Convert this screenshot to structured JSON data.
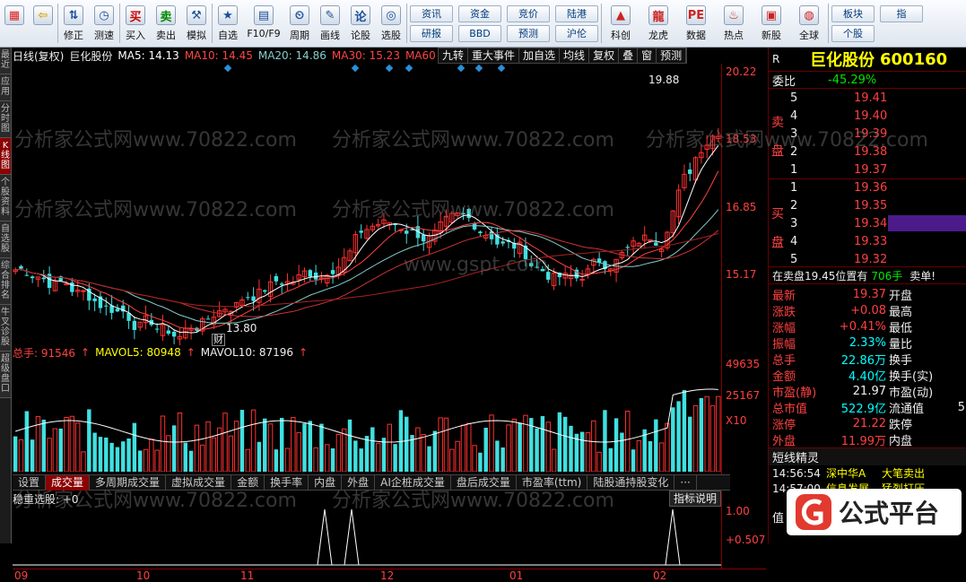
{
  "toolbar": {
    "buttons": [
      {
        "label": "",
        "icon": "windows-logo-icon"
      },
      {
        "label": "",
        "icon": "back-arrow-icon"
      },
      {
        "label": "修正",
        "icon": "up-down-arrows-icon"
      },
      {
        "label": "测速",
        "icon": "clock-icon"
      },
      {
        "label": "买入",
        "icon": "buy-icon",
        "glyph": "买"
      },
      {
        "label": "卖出",
        "icon": "sell-icon",
        "glyph": "卖"
      },
      {
        "label": "模拟",
        "icon": "hammer-icon"
      },
      {
        "label": "自选",
        "icon": "star-folder-icon"
      },
      {
        "label": "F10/F9",
        "icon": "f10-icon"
      },
      {
        "label": "周期",
        "icon": "period-icon"
      },
      {
        "label": "画线",
        "icon": "pencil-icon"
      },
      {
        "label": "论股",
        "icon": "discuss-icon"
      },
      {
        "label": "选股",
        "icon": "select-stock-icon"
      }
    ],
    "dual_buttons": [
      [
        "资讯",
        "研报"
      ],
      [
        "资金",
        "BBD"
      ],
      [
        "竞价",
        "预测"
      ],
      [
        "陆港",
        "沪伦"
      ]
    ],
    "buttons2": [
      {
        "label": "科创",
        "icon": "kechuang-icon"
      },
      {
        "label": "龙虎",
        "icon": "dragon-tiger-icon"
      },
      {
        "label": "数据",
        "icon": "data-icon",
        "glyph": "PE"
      },
      {
        "label": "热点",
        "icon": "hot-icon"
      },
      {
        "label": "新股",
        "icon": "new-stock-icon"
      },
      {
        "label": "全球",
        "icon": "globe-icon"
      }
    ],
    "dual_buttons2": [
      [
        "板块",
        "个股"
      ],
      [
        "指",
        ""
      ]
    ]
  },
  "sidebar": [
    {
      "label": "最近",
      "active": false
    },
    {
      "label": "应用",
      "active": false
    },
    {
      "label": "分时图",
      "active": false
    },
    {
      "label": "K线图",
      "active": true
    },
    {
      "label": "个股资料",
      "active": false
    },
    {
      "label": "自选股",
      "active": false
    },
    {
      "label": "综合排名",
      "active": false
    },
    {
      "label": "牛叉诊股",
      "active": false
    },
    {
      "label": "超级盘口",
      "active": false
    }
  ],
  "kline_header": {
    "period": "日线(复权)",
    "name": "巨化股份",
    "ma": [
      {
        "label": "MA5: 14.13",
        "color": "#ffffff"
      },
      {
        "label": "MA10: 14.45",
        "color": "#ff4444"
      },
      {
        "label": "MA20: 14.86",
        "color": "#88cccc"
      },
      {
        "label": "MA30: 15.23",
        "color": "#ff4444"
      },
      {
        "label": "MA60",
        "color": "#ff4444"
      }
    ],
    "buttons": [
      "九转",
      "重大事件",
      "加自选",
      "均线",
      "复权",
      "叠",
      "窗",
      "预测"
    ]
  },
  "price_axis": [
    "20.22",
    "18.53",
    "16.85",
    "15.17"
  ],
  "annotations": {
    "high": "19.88",
    "low": "13.80",
    "fin_mark": "财"
  },
  "volume_header": {
    "total": "总手: 91546",
    "mavol5": "MAVOL5: 80948",
    "mavol10": "MAVOL10: 87196"
  },
  "volume_axis": [
    "49635",
    "25167",
    "X10"
  ],
  "tabs": [
    "设置",
    "成交量",
    "多周期成交量",
    "虚拟成交量",
    "金额",
    "换手率",
    "内盘",
    "外盘",
    "AI企桩成交量",
    "盘后成交量",
    "市盈率(ttm)",
    "陆股通持股变化",
    "···"
  ],
  "active_tab": "成交量",
  "indicator": {
    "title": "稳重选股: +0",
    "button": "指标说明",
    "axis": [
      "1.00",
      "+0.507"
    ]
  },
  "x_axis": [
    "09",
    "10",
    "11",
    "12",
    "01",
    "02"
  ],
  "quote": {
    "flag": "R",
    "name": "巨化股份",
    "code": "600160",
    "weibi_label": "委比",
    "weibi": "-45.29%",
    "sell_side": "卖盘",
    "buy_side": "买盘",
    "asks": [
      {
        "n": "5",
        "p": "19.41"
      },
      {
        "n": "4",
        "p": "19.40"
      },
      {
        "n": "3",
        "p": "19.39"
      },
      {
        "n": "2",
        "p": "19.38"
      },
      {
        "n": "1",
        "p": "19.37"
      }
    ],
    "bids": [
      {
        "n": "1",
        "p": "19.36"
      },
      {
        "n": "2",
        "p": "19.35"
      },
      {
        "n": "3",
        "p": "19.34"
      },
      {
        "n": "4",
        "p": "19.33"
      },
      {
        "n": "5",
        "p": "19.32"
      }
    ],
    "notice": "在卖盘19.45位置有",
    "notice_qty": "706手",
    "notice_tail": "卖单!",
    "stats": [
      {
        "l": "最新",
        "v": "19.37",
        "r": "开盘",
        "vc": "red"
      },
      {
        "l": "涨跌",
        "v": "+0.08",
        "r": "最高",
        "vc": "red"
      },
      {
        "l": "涨幅",
        "v": "+0.41%",
        "r": "最低",
        "vc": "red"
      },
      {
        "l": "振幅",
        "v": "2.33%",
        "r": "量比",
        "vc": "cyan"
      },
      {
        "l": "总手",
        "v": "22.86万",
        "r": "换手",
        "vc": "cyan"
      },
      {
        "l": "金额",
        "v": "4.40亿",
        "r": "换手(实)",
        "vc": "cyan"
      },
      {
        "l": "市盈(静)",
        "v": "21.97",
        "r": "市盈(动)",
        "vc": "white"
      },
      {
        "l": "总市值",
        "v": "522.9亿",
        "r": "流通值",
        "vc": "cyan"
      },
      {
        "l": "涨停",
        "v": "21.22",
        "r": "跌停",
        "vc": "red"
      },
      {
        "l": "外盘",
        "v": "11.99万",
        "r": "内盘",
        "vc": "red"
      }
    ],
    "stats_right_num": "5",
    "short_title": "短线精灵",
    "short": [
      {
        "t": "14:56:54",
        "name": "深中华A",
        "act": "大笔卖出"
      },
      {
        "t": "14:57:00",
        "name": "信息发展",
        "act": "猛烈打压"
      }
    ],
    "bottom_char": "值"
  },
  "watermarks": [
    "分析家公式网www.70822.com",
    "www.gspt.com"
  ],
  "logo": {
    "text": "公式平台",
    "icon": "gspt-logo-icon"
  }
}
